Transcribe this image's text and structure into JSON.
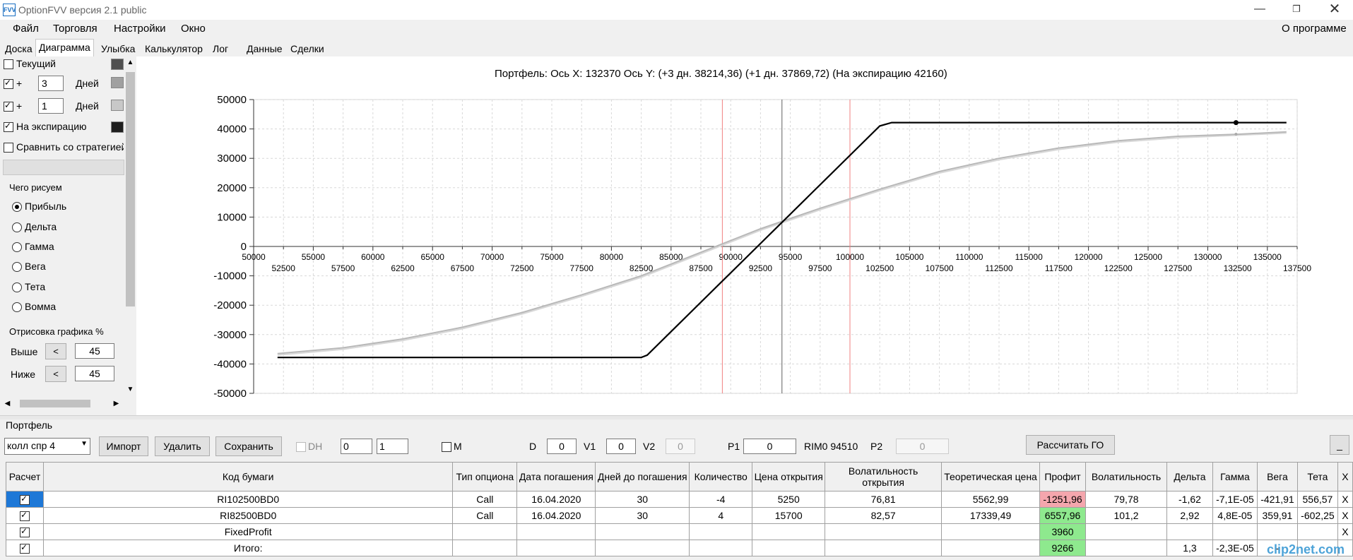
{
  "window": {
    "title": "OptionFVV версия 2.1 public",
    "icon_text": "FVV"
  },
  "menu": {
    "items": [
      "Файл",
      "Торговля",
      "Настройки",
      "Окно"
    ],
    "about": "О программе"
  },
  "tabs": [
    "Доска",
    "Диаграмма",
    "Улыбка",
    "Калькулятор",
    "Лог",
    "Данные",
    "Сделки"
  ],
  "left_panel": {
    "current_label": "Текущий",
    "plus": "+",
    "days_label": "Дней",
    "days1": "3",
    "days2": "1",
    "expiry_label": "На экспирацию",
    "compare_label": "Сравнить со стратегией",
    "what_draw_title": "Чего рисуем",
    "radios": [
      "Прибыль",
      "Дельта",
      "Гамма",
      "Вега",
      "Тета",
      "Вомма"
    ],
    "selected_radio": "Прибыль",
    "draw_pct_title": "Отрисовка графика %",
    "above_label": "Выше",
    "below_label": "Ниже",
    "arrow_btn": "<",
    "above_value": "45",
    "below_value": "45",
    "swatch_colors": [
      "#505050",
      "#a0a0a0",
      "#c8c8c8",
      "#1e1e1e"
    ]
  },
  "chart_data": {
    "type": "line",
    "title": "Портфель: Ось X: 132370 Ось Y:  (+3 дн. 38214,36)  (+1 дн. 37869,72)  (На экспирацию 42160)",
    "xlim": [
      50000,
      137500
    ],
    "ylim": [
      -50000,
      50000
    ],
    "x_ticks_upper": [
      "50000",
      "55000",
      "60000",
      "65000",
      "70000",
      "75000",
      "80000",
      "85000",
      "90000",
      "95000",
      "100000",
      "105000",
      "110000",
      "115000",
      "120000",
      "125000",
      "130000",
      "135000"
    ],
    "x_ticks_lower": [
      "52500",
      "57500",
      "62500",
      "67500",
      "72500",
      "77500",
      "82500",
      "87500",
      "92500",
      "97500",
      "102500",
      "107500",
      "112500",
      "117500",
      "122500",
      "127500",
      "132500",
      "137500"
    ],
    "y_ticks": [
      "50000",
      "40000",
      "30000",
      "20000",
      "10000",
      "0",
      "-10000",
      "-20000",
      "-30000",
      "-40000",
      "-50000"
    ],
    "grid": true,
    "vertical_markers": [
      {
        "x": 89300,
        "color": "#f08080"
      },
      {
        "x": 94300,
        "color": "#606060"
      },
      {
        "x": 100000,
        "color": "#f08080"
      }
    ],
    "series": [
      {
        "color": "#000000",
        "x": [
          52000,
          82500,
          83000,
          102500,
          103500,
          136600
        ],
        "y": [
          -37800,
          -37800,
          -37000,
          41000,
          42160,
          42160
        ]
      },
      {
        "color": "#b8b8b8",
        "x": [
          52000,
          57500,
          62500,
          67500,
          72500,
          77500,
          82500,
          87500,
          92500,
          97500,
          102500,
          107500,
          112500,
          117500,
          122500,
          127500,
          132500,
          136600
        ],
        "y": [
          -36500,
          -34500,
          -31500,
          -27500,
          -22500,
          -16500,
          -10000,
          -2000,
          6000,
          13000,
          19500,
          25500,
          30000,
          33500,
          36000,
          37500,
          38200,
          39000
        ]
      },
      {
        "color": "#d8d8d8",
        "x": [
          52000,
          57500,
          62500,
          67500,
          72500,
          77500,
          82500,
          87500,
          92500,
          97500,
          102500,
          107500,
          112500,
          117500,
          122500,
          127500,
          132500,
          136600
        ],
        "y": [
          -37000,
          -35000,
          -32000,
          -28000,
          -23000,
          -17000,
          -10500,
          -2500,
          5500,
          12500,
          19000,
          25000,
          29500,
          33000,
          35500,
          37000,
          37870,
          38600
        ]
      }
    ],
    "cursor_point": {
      "x": 132370,
      "y": 42160
    }
  },
  "portfolio": {
    "title": "Портфель",
    "combo_value": "колл спр 4",
    "import_btn": "Импорт",
    "delete_btn": "Удалить",
    "save_btn": "Сохранить",
    "dh_label": "DH",
    "spin1": "0",
    "spin2": "1",
    "m_label": "M",
    "d_label": "D",
    "d_value": "0",
    "v1_label": "V1",
    "v1_value": "0",
    "v2_label": "V2",
    "v2_value": "0",
    "p1_label": "P1",
    "p1_value": "0",
    "rim_label": "RIM0 94510",
    "p2_label": "P2",
    "p2_value": "0",
    "calc_go_btn": "Рассчитать ГО",
    "minimize_btn": "_",
    "columns": [
      "Расчет",
      "Код бумаги",
      "Тип опциона",
      "Дата погашения",
      "Дней до погашения",
      "Количество",
      "Цена открытия",
      "Волатильность открытия",
      "Теоретическая цена",
      "Профит",
      "Волатильность",
      "Дельта",
      "Гамма",
      "Вега",
      "Тета",
      "X"
    ],
    "rows": [
      {
        "code": "RI102500BD0",
        "type": "Call",
        "date": "16.04.2020",
        "days": "30",
        "qty": "-4",
        "price": "5250",
        "vol_open": "76,81",
        "theo": "5562,99",
        "profit": "-1251,96",
        "vol": "79,78",
        "delta": "-1,62",
        "gamma": "-7,1E-05",
        "vega": "-421,91",
        "theta": "556,57",
        "x": "X"
      },
      {
        "code": "RI82500BD0",
        "type": "Call",
        "date": "16.04.2020",
        "days": "30",
        "qty": "4",
        "price": "15700",
        "vol_open": "82,57",
        "theo": "17339,49",
        "profit": "6557,96",
        "vol": "101,2",
        "delta": "2,92",
        "gamma": "4,8E-05",
        "vega": "359,91",
        "theta": "-602,25",
        "x": "X"
      },
      {
        "code": "FixedProfit",
        "type": "",
        "date": "",
        "days": "",
        "qty": "",
        "price": "",
        "vol_open": "",
        "theo": "",
        "profit": "3960",
        "vol": "",
        "delta": "",
        "gamma": "",
        "vega": "",
        "theta": "",
        "x": "X"
      },
      {
        "code": "Итого:",
        "type": "",
        "date": "",
        "days": "",
        "qty": "",
        "price": "",
        "vol_open": "",
        "theo": "",
        "profit": "9266",
        "vol": "",
        "delta": "1,3",
        "gamma": "-2,3E-05",
        "vega": "-",
        "theta": "",
        "x": ""
      }
    ]
  },
  "watermark": "clip2net.com"
}
